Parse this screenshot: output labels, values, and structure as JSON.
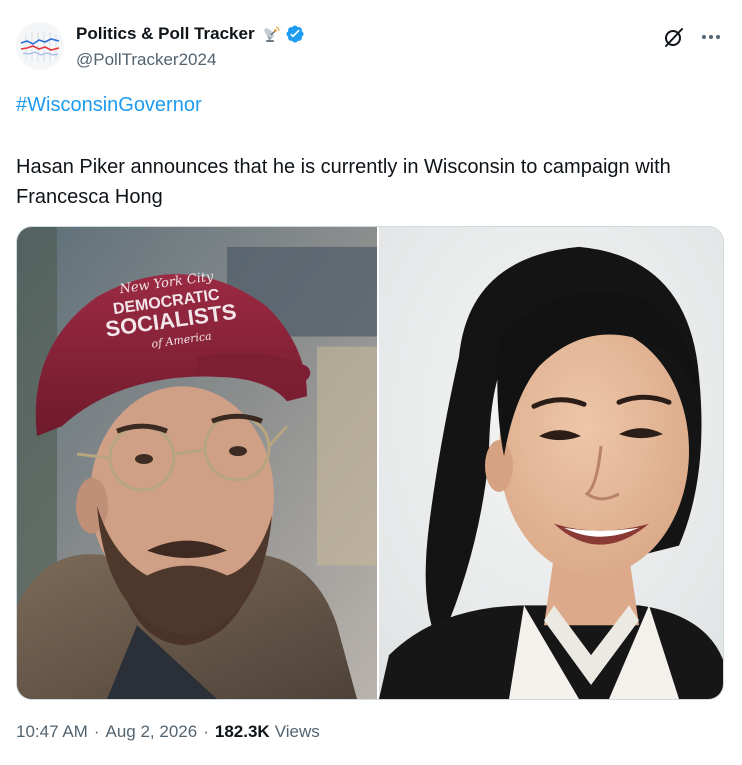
{
  "author": {
    "display_name": "Politics & Poll Tracker",
    "handle": "@PollTracker2024",
    "emoji_icon": "satellite-antenna-icon",
    "verified_icon": "verified-badge-icon",
    "verified_color": "#1d9bf0"
  },
  "header_actions": {
    "grok_icon": "grok-icon",
    "more_icon": "more-options-icon"
  },
  "tweet": {
    "hashtag": "#WisconsinGovernor",
    "text": "Hasan Piker announces that he is currently in Wisconsin to campaign with Francesca Hong"
  },
  "media": {
    "photos": [
      {
        "name": "photo-man-red-cap",
        "cap_text": [
          "New York City",
          "DEMOCRATIC",
          "SOCIALISTS",
          "of America"
        ]
      },
      {
        "name": "photo-woman-smiling"
      }
    ]
  },
  "meta": {
    "time": "10:47 AM",
    "separator": "·",
    "date": "Aug 2, 2026",
    "views_count": "182.3K",
    "views_label": "Views"
  },
  "colors": {
    "text_primary": "#0f1419",
    "text_secondary": "#536471",
    "link": "#1d9bf0",
    "cap_red": "#8b2237"
  }
}
